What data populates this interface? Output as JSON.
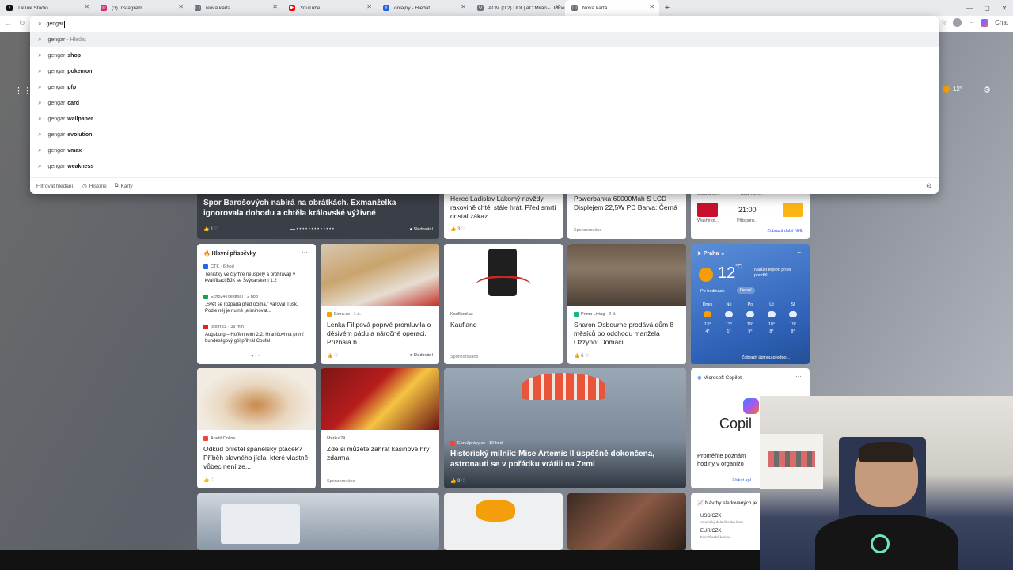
{
  "tabs": [
    {
      "title": "TikTok Studio",
      "color": "#111111",
      "glyph": "♪"
    },
    {
      "title": "(3) Instagram",
      "color": "#d62976",
      "glyph": "◎"
    },
    {
      "title": "Nová karta",
      "color": "#6b7280",
      "glyph": "▢"
    },
    {
      "title": "YouTube",
      "color": "#ff0000",
      "glyph": "▶"
    },
    {
      "title": "onlajny - Hledat",
      "color": "#2563eb",
      "glyph": "⌕"
    },
    {
      "title": "ACM (0:2) UDI | AC Milán - Udines",
      "color": "#6b7280",
      "glyph": "↻"
    },
    {
      "title": "Nová karta",
      "color": "#6b7280",
      "glyph": "▢"
    }
  ],
  "toolbar": {
    "chat_label": "Chat"
  },
  "omnibox": {
    "query": "gengar",
    "top_suggestion": {
      "prefix": "gengar",
      "suffix": "- Hledat"
    },
    "suggestions": [
      {
        "prefix": "gengar",
        "bold": "shop"
      },
      {
        "prefix": "gengar",
        "bold": "pokemon"
      },
      {
        "prefix": "gengar",
        "bold": "pfp"
      },
      {
        "prefix": "gengar",
        "bold": "card"
      },
      {
        "prefix": "gengar",
        "bold": "wallpaper"
      },
      {
        "prefix": "gengar",
        "bold": "evolution"
      },
      {
        "prefix": "gengar",
        "bold": "vmax"
      },
      {
        "prefix": "gengar",
        "bold": "weakness"
      }
    ],
    "footer": {
      "filter_label": "Filtrovat hledání:",
      "history_label": "Historie",
      "tabs_label": "Karty"
    }
  },
  "top_weather": {
    "city": "ha",
    "temp": "12°"
  },
  "feed": {
    "card1": {
      "title": "Spor Barošových nabírá na obrátkách. Exmanželka ignorovala dohodu a chtěla královské výživné",
      "likes": "1",
      "follow": "Sledování"
    },
    "card2": {
      "title": "Herec Ladislav Lakomý navždy rakovině chtěl stále hrát. Před smrtí dostal zákaz",
      "likes": "3"
    },
    "card3": {
      "title": "Powerbanka 60000Mah S LCD Displejem 22,5W PD Barva: Černá",
      "sponsor": "Sponzorováno"
    },
    "nhl": {
      "team1": "Ottawa S...",
      "team2": "New York...",
      "time": "21:00",
      "team3": "Washingt...",
      "team4": "Pittsburg...",
      "more": "Zobrazit další NHL"
    },
    "main_posts": {
      "header": "Hlavní příspěvky",
      "items": [
        {
          "source": "ČTK · 6 hod",
          "text": "Tenisťky ve čtyřhře neuspěly a prohrávají v kvalifikaci BJK se Švýcarskem 1:2"
        },
        {
          "source": "Echo24 (čeština) · 2 hod",
          "text": "„Svět se rozpadá před očima,\" varoval Tusk. Podle něj je nutné „eliminovat..."
        },
        {
          "source": "isport.cz · 39 min",
          "text": "Augsburg – Hoffenheim 2:2. Hraničovi na první bundesligový gól přihrál Coufal"
        }
      ]
    },
    "lenka": {
      "source": "Extra.cz · 1 d.",
      "title": "Lenka Filipová poprvé promluvila o děsivém pádu a náročné operaci. Přiznala b...",
      "follow": "Sledování"
    },
    "kaufland": {
      "source": "Kaufland.cz",
      "title": "Kaufland",
      "sponsor": "Sponzorováno"
    },
    "sharon": {
      "source": "Prima Living · 2 d.",
      "title": "Sharon Osbourne prodává dům 8 měsíců po odchodu manžela Ozzyho: Domácí...",
      "likes": "6"
    },
    "weather": {
      "city": "Praha",
      "temp": "12",
      "unit": "°C",
      "note": "Nárůst teplot: příští pondělí",
      "tab_hourly": "Po hodinách",
      "tab_daily": "Denní",
      "days": [
        {
          "day": "Dnes",
          "hi": "13°",
          "lo": "4°"
        },
        {
          "day": "Ne",
          "hi": "13°",
          "lo": "1°"
        },
        {
          "day": "Po",
          "hi": "19°",
          "lo": "9°"
        },
        {
          "day": "Út",
          "hi": "18°",
          "lo": "8°"
        },
        {
          "day": "St",
          "hi": "19°",
          "lo": "8°"
        }
      ],
      "more": "Zobrazit úplnou předpo..."
    },
    "recipe": {
      "source": "Apetit Online",
      "title": "Odkud přiletěl španělský ptáček? Příběh slavného jídla, které vlastně vůbec není ze..."
    },
    "casino": {
      "source": "Merkur24",
      "title": "Zde si můžete zahrát kasinové hry zdarma",
      "sponsor": "Sponzorováno"
    },
    "artemis": {
      "source": "EuroZprávy.cz · 10 hod",
      "title": "Historický milník: Mise Artemis II úspěšně dokončena, astronauti se v pořádku vrátili na Zemi",
      "likes": "9"
    },
    "copilot": {
      "header": "Microsoft Copilot",
      "brand": "Copil",
      "text": "Proměňte poznám hodiny v organizo",
      "cta": "Získat apl"
    },
    "currency": {
      "header": "Návrhy sledovaných je",
      "pair1": "USD/CZK",
      "pair1_desc": "Americký dolar/Česká koru",
      "pair2": "EUR/CZK",
      "pair2_desc": "Euro/Česká koruna"
    }
  }
}
